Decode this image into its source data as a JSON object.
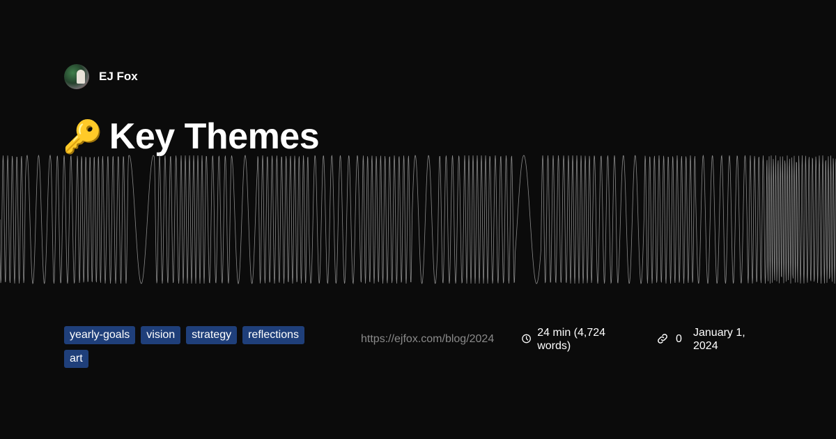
{
  "author": {
    "name": "EJ Fox"
  },
  "post": {
    "emoji": "🔑",
    "title": "Key Themes"
  },
  "tags": [
    "yearly-goals",
    "vision",
    "strategy",
    "reflections",
    "art"
  ],
  "meta": {
    "url": "https://ejfox.com/blog/2024",
    "reading_time": "24 min (4,724 words)",
    "links_count": "0",
    "date": "January 1, 2024"
  },
  "colors": {
    "tag_bg": "#1f3f7a",
    "wave": "#8a8a8a",
    "background": "#0b0b0b"
  }
}
